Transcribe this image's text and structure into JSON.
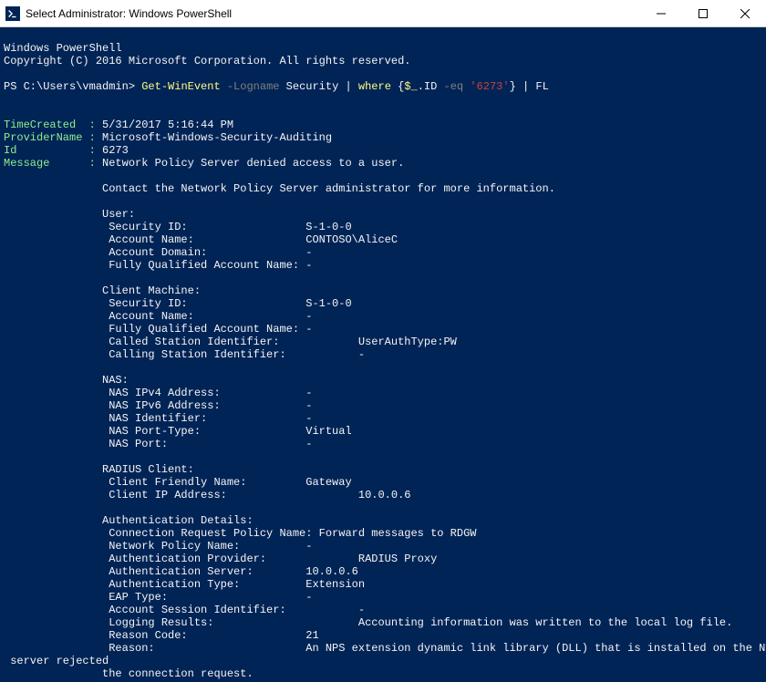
{
  "titlebar": {
    "label": "Select Administrator: Windows PowerShell"
  },
  "banner": {
    "line1": "Windows PowerShell",
    "line2": "Copyright (C) 2016 Microsoft Corporation. All rights reserved."
  },
  "prompt": {
    "ps": "PS ",
    "path": "C:\\Users\\vmadmin>",
    "cmdlet": " Get-WinEvent",
    "param": " -Logname",
    "arg1": " Security |",
    "where": " where",
    "brace_open": " {",
    "var": "$_",
    "dot_id": ".ID",
    "op": " -eq",
    "number": " '6273'",
    "brace_close": "}",
    "pipe_fl": " | FL"
  },
  "fields": {
    "timecreated_label": "TimeCreated  :",
    "timecreated_value": " 5/31/2017 5:16:44 PM",
    "provider_label": "ProviderName :",
    "provider_value": " Microsoft-Windows-Security-Auditing",
    "id_label": "Id           :",
    "id_value": " 6273",
    "message_label": "Message      :",
    "message_value": " Network Policy Server denied access to a user."
  },
  "body": {
    "l01": "               Contact the Network Policy Server administrator for more information.",
    "l02": "               User:",
    "l03": "                Security ID:                  S-1-0-0",
    "l04": "                Account Name:                 CONTOSO\\AliceC",
    "l05": "                Account Domain:               -",
    "l06": "                Fully Qualified Account Name: -",
    "l07": "               Client Machine:",
    "l08": "                Security ID:                  S-1-0-0",
    "l09": "                Account Name:                 -",
    "l10": "                Fully Qualified Account Name: -",
    "l11": "                Called Station Identifier:            UserAuthType:PW",
    "l12": "                Calling Station Identifier:           -",
    "l13": "               NAS:",
    "l14": "                NAS IPv4 Address:             -",
    "l15": "                NAS IPv6 Address:             -",
    "l16": "                NAS Identifier:               -",
    "l17": "                NAS Port-Type:                Virtual",
    "l18": "                NAS Port:                     -",
    "l19": "               RADIUS Client:",
    "l20": "                Client Friendly Name:         Gateway",
    "l21": "                Client IP Address:                    10.0.0.6",
    "l22": "               Authentication Details:",
    "l23": "                Connection Request Policy Name: Forward messages to RDGW",
    "l24": "                Network Policy Name:          -",
    "l25": "                Authentication Provider:              RADIUS Proxy",
    "l26": "                Authentication Server:        10.0.0.6",
    "l27": "                Authentication Type:          Extension",
    "l28": "                EAP Type:                     -",
    "l29": "                Account Session Identifier:           -",
    "l30": "                Logging Results:                      Accounting information was written to the local log file.",
    "l31": "                Reason Code:                  21",
    "l32": "                Reason:                       An NPS extension dynamic link library (DLL) that is installed on the NPS",
    "l33": " server rejected",
    "l34": "               the connection request."
  }
}
